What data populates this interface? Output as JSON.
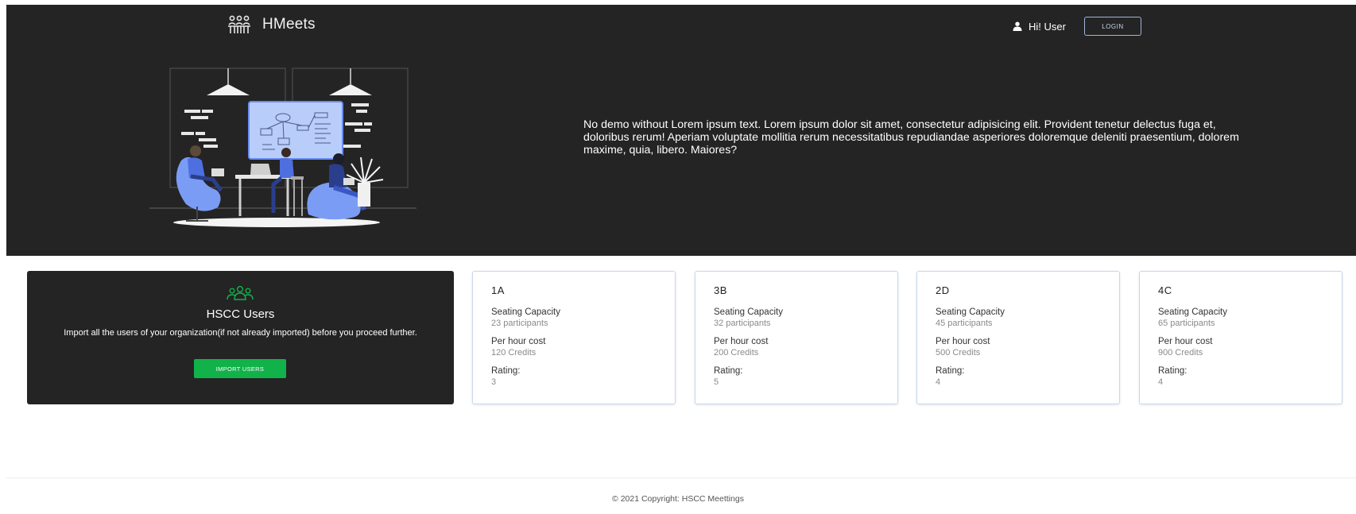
{
  "header": {
    "brand": "HMeets",
    "brand_icon": "meeting-people-icon",
    "greeting": "Hi! User",
    "login_label": "LOGIN"
  },
  "hero": {
    "text": "No demo without Lorem ipsum text. Lorem ipsum dolor sit amet, consectetur adipisicing elit. Provident tenetur delectus fuga et, doloribus rerum! Aperiam voluptate mollitia rerum necessitatibus repudiandae asperiores doloremque deleniti praesentium, dolorem maxime, quia, libero. Maiores?"
  },
  "import_card": {
    "icon": "users-group-icon",
    "title": "HSCC Users",
    "description": "Import all the users of your organization(if not already imported) before you proceed further.",
    "button_label": "IMPORT USERS"
  },
  "rooms": [
    {
      "name": "1A",
      "capacity_label": "Seating Capacity",
      "capacity": "23 participants",
      "cost_label": "Per hour cost",
      "cost": "120 Credits",
      "rating_label": "Rating:",
      "rating": "3"
    },
    {
      "name": "3B",
      "capacity_label": "Seating Capacity",
      "capacity": "32 participants",
      "cost_label": "Per hour cost",
      "cost": "200 Credits",
      "rating_label": "Rating:",
      "rating": "5"
    },
    {
      "name": "2D",
      "capacity_label": "Seating Capacity",
      "capacity": "45 participants",
      "cost_label": "Per hour cost",
      "cost": "500 Credits",
      "rating_label": "Rating:",
      "rating": "4"
    },
    {
      "name": "4C",
      "capacity_label": "Seating Capacity",
      "capacity": "65 participants",
      "cost_label": "Per hour cost",
      "cost": "900 Credits",
      "rating_label": "Rating:",
      "rating": "4"
    }
  ],
  "footer": {
    "copyright": "© 2021 Copyright: HSCC Meettings"
  },
  "colors": {
    "dark_bg": "#242424",
    "accent_green": "#12b24a",
    "illustration_blue": "#7b9cf5",
    "card_border": "#c9d7ec"
  }
}
